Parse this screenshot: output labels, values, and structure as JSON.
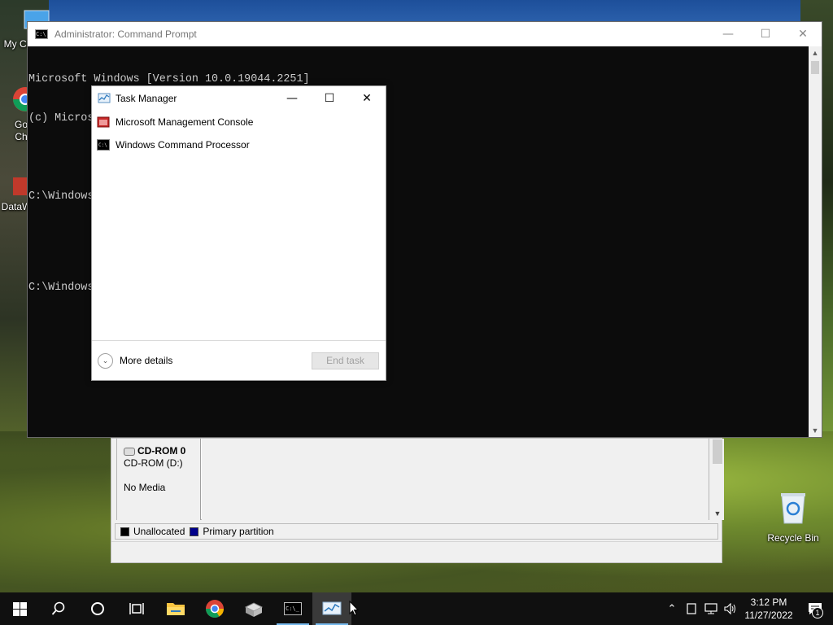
{
  "desktop": {
    "icons": [
      {
        "label": "My Co",
        "icon": "this-pc-icon"
      },
      {
        "label": "Go Ch",
        "icon": "chrome-shortcut-icon"
      },
      {
        "label": "DataW",
        "icon": "datawarehouse-shortcut-icon"
      }
    ],
    "recycle_bin": {
      "label": "Recycle Bin",
      "icon": "recycle-bin-icon"
    }
  },
  "cmd_window": {
    "title": "Administrator: Command Prompt",
    "lines": [
      "Microsoft Windows [Version 10.0.19044.2251]",
      "(c) Microsoft Corporation. All rights reserved.",
      "",
      "C:\\Windows",
      "",
      "C:\\Windows"
    ],
    "buttons": {
      "minimize": "—",
      "maximize": "☐",
      "close": "✕"
    }
  },
  "task_manager": {
    "title": "Task Manager",
    "apps": [
      {
        "name": "Microsoft Management Console",
        "icon": "mmc-icon"
      },
      {
        "name": "Windows Command Processor",
        "icon": "cmd-icon"
      }
    ],
    "more_details": "More details",
    "end_task": "End task",
    "buttons": {
      "minimize": "—",
      "maximize": "☐",
      "close": "✕"
    }
  },
  "disk_management": {
    "disk": {
      "name": "CD-ROM 0",
      "type": "CD-ROM (D:)",
      "media": "No Media"
    },
    "legend": [
      {
        "label": "Unallocated",
        "color": "#000000"
      },
      {
        "label": "Primary partition",
        "color": "#00008b"
      }
    ]
  },
  "taskbar": {
    "items": [
      {
        "name": "start",
        "icon": "windows-logo-icon"
      },
      {
        "name": "search",
        "icon": "search-icon"
      },
      {
        "name": "cortana",
        "icon": "cortana-circle-icon"
      },
      {
        "name": "task-view",
        "icon": "task-view-icon"
      },
      {
        "name": "file-explorer",
        "icon": "folder-icon"
      },
      {
        "name": "chrome",
        "icon": "chrome-icon"
      },
      {
        "name": "server-manager",
        "icon": "server-manager-icon"
      },
      {
        "name": "command-prompt",
        "icon": "cmd-icon"
      },
      {
        "name": "task-manager",
        "icon": "task-manager-icon"
      }
    ],
    "clock": {
      "time": "3:12 PM",
      "date": "11/27/2022"
    },
    "notifications_count": "1"
  },
  "colors": {
    "accent": "#76b9ed",
    "console_bg": "#0c0c0c",
    "console_fg": "#cccccc"
  }
}
